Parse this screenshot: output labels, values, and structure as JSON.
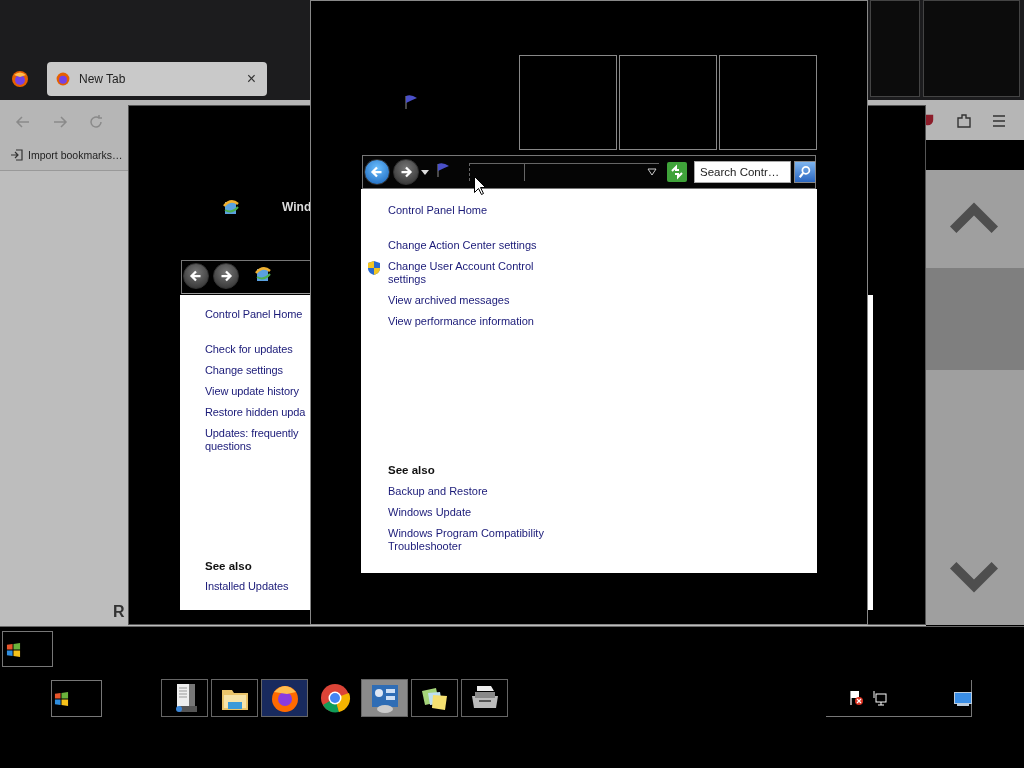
{
  "browser": {
    "tab": {
      "title": "New Tab",
      "close": "×",
      "selected": true
    },
    "bookmarks": [
      {
        "label": "Import bookmarks…"
      }
    ],
    "page_text": "R"
  },
  "update_window": {
    "title": "Wind",
    "nav": {
      "back": {
        "disabled": true
      },
      "forward": {
        "disabled": true
      }
    },
    "home": "Control Panel Home",
    "tasks": [
      {
        "lines": [
          "Check for updates"
        ]
      },
      {
        "lines": [
          "Change settings"
        ]
      },
      {
        "lines": [
          "View update history"
        ]
      },
      {
        "lines": [
          "Restore hidden upda"
        ]
      },
      {
        "lines": [
          "Updates: frequently",
          "questions"
        ]
      }
    ],
    "see_also_heading": "See also",
    "see_also": [
      {
        "lines": [
          "Installed Updates"
        ]
      }
    ]
  },
  "action_center": {
    "nav": {
      "back": {
        "disabled": false
      },
      "forward": {
        "disabled": true
      }
    },
    "search": {
      "placeholder": "Search Contr…"
    },
    "home": "Control Panel Home",
    "tasks": [
      {
        "lines": [
          "Change Action Center settings"
        ],
        "shield": false
      },
      {
        "lines": [
          "Change User Account Control",
          "settings"
        ],
        "shield": true
      },
      {
        "lines": [
          "View archived messages"
        ],
        "shield": false
      },
      {
        "lines": [
          "View performance information"
        ],
        "shield": false
      }
    ],
    "see_also_heading": "See also",
    "see_also": [
      {
        "lines": [
          "Backup and Restore"
        ]
      },
      {
        "lines": [
          "Windows Update"
        ]
      },
      {
        "lines": [
          "Windows Program Compatibility",
          "Troubleshooter"
        ]
      }
    ]
  },
  "taskbar": {
    "items": [
      {
        "kind": "server",
        "selected": false
      },
      {
        "kind": "folder",
        "selected": false
      },
      {
        "kind": "firefox",
        "selected": true
      },
      {
        "kind": "chrome",
        "selected": false
      },
      {
        "kind": "control-panel",
        "selected": true
      },
      {
        "kind": "notes",
        "selected": false
      },
      {
        "kind": "fax",
        "selected": false
      }
    ]
  }
}
